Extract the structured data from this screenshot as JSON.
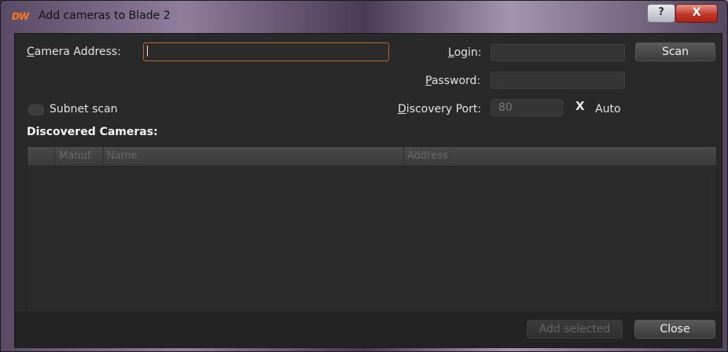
{
  "window": {
    "title": "Add cameras to Blade 2",
    "logo_text": "DW",
    "help_button": "?",
    "close_button": "X",
    "accent_color": "#ff7a1a"
  },
  "form": {
    "camera_address_label_u": "C",
    "camera_address_label_rest": "amera Address:",
    "camera_address_value": "",
    "login_label_u": "L",
    "login_label_rest": "ogin:",
    "login_value": "",
    "password_label_u": "P",
    "password_label_rest": "assword:",
    "password_value": "",
    "scan_button": "Scan",
    "subnet_scan_label": "Subnet scan",
    "discovery_port_label_u": "D",
    "discovery_port_label_rest": "iscovery Port:",
    "discovery_port_value": "80",
    "auto_check": "X",
    "auto_label": "Auto"
  },
  "discovered": {
    "title": "Discovered Cameras:",
    "columns": [
      "Manuf.",
      "Name",
      "Address"
    ],
    "rows": []
  },
  "footer": {
    "add_selected_button": "Add selected",
    "close_button": "Close"
  }
}
